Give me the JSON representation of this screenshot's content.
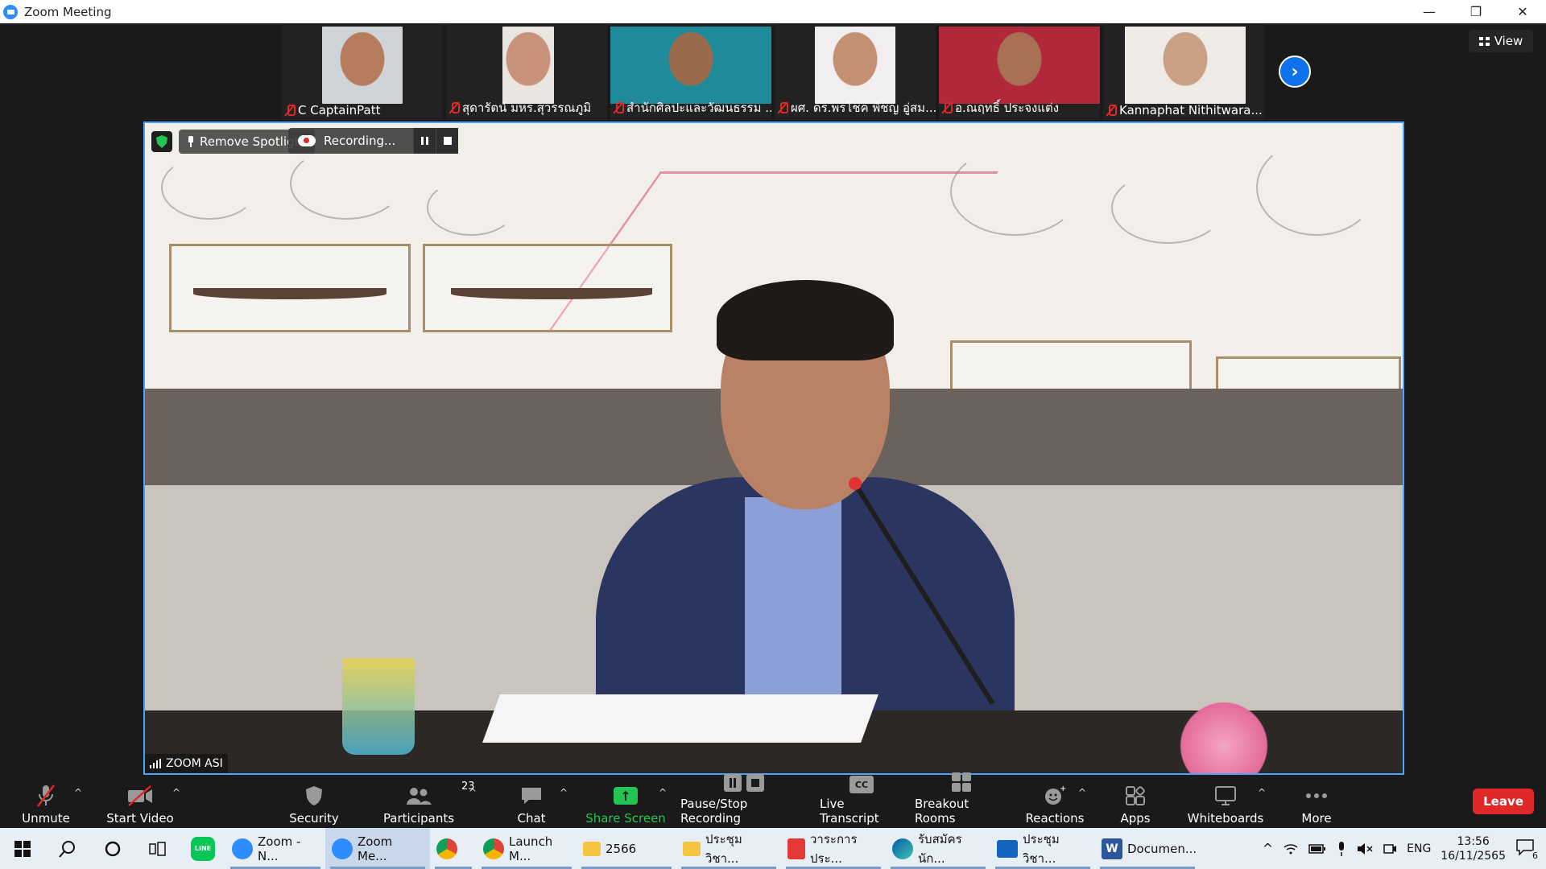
{
  "window": {
    "title": "Zoom Meeting",
    "controls": [
      "—",
      "❐",
      "✕"
    ]
  },
  "view_button": {
    "label": "View"
  },
  "participants_strip": [
    {
      "name": "C CaptainPatt",
      "bg": "#cfd4d8",
      "skin": "#b57d5e"
    },
    {
      "name": "สุดารัตน์ มหร.สุวรรณภูมิ",
      "bg": "#e9e6e2",
      "skin": "#c9927a"
    },
    {
      "name": "สำนักศิลปะและวัฒนธรรม ...",
      "bg": "#1f8a9a",
      "skin": "#9a6a4c"
    },
    {
      "name": "ผศ. ดร.พรโชค พิชญ อู่สม...",
      "bg": "#f0eeee",
      "skin": "#c49072"
    },
    {
      "name": "อ.ณฤทธิ์ ประจงแต่ง",
      "bg": "#b0283a",
      "skin": "#a87055"
    },
    {
      "name": "Kannaphat Nithitwara...",
      "bg": "#eeeae6",
      "skin": "#caa085"
    }
  ],
  "spotlight": {
    "remove_label": "Remove Spotlight",
    "recording_label": "Recording...",
    "network_label": "ZOOM ASI"
  },
  "toolbar": {
    "unmute": "Unmute",
    "start_video": "Start Video",
    "security": "Security",
    "participants": "Participants",
    "participants_count": "23",
    "chat": "Chat",
    "share_screen": "Share Screen",
    "pause_stop_recording": "Pause/Stop Recording",
    "live_transcript": "Live Transcript",
    "cc_label": "CC",
    "breakout_rooms": "Breakout Rooms",
    "reactions": "Reactions",
    "apps": "Apps",
    "whiteboards": "Whiteboards",
    "more": "More",
    "leave": "Leave"
  },
  "taskbar": {
    "apps": [
      {
        "label": "Zoom - N...",
        "color": "#2d8cff",
        "active": false
      },
      {
        "label": "Zoom Me...",
        "color": "#2d8cff",
        "active": true
      },
      {
        "label": "",
        "color": "#db4437",
        "active": false
      },
      {
        "label": "Launch M...",
        "color": "#db4437",
        "active": false
      },
      {
        "label": "2566",
        "color": "#f5c542",
        "active": false
      },
      {
        "label": "ประชุมวิชา...",
        "color": "#f5c542",
        "active": false
      },
      {
        "label": "วาระการประ...",
        "color": "#e53935",
        "active": false
      },
      {
        "label": "รับสมัครนัก...",
        "color": "#1e88e5",
        "active": false
      },
      {
        "label": "ประชุมวิชา...",
        "color": "#1565c0",
        "active": false
      },
      {
        "label": "Documen...",
        "color": "#2b579a",
        "active": false
      }
    ],
    "language": "ENG",
    "time": "13:56",
    "date": "16/11/2565",
    "notification_count": "6"
  }
}
